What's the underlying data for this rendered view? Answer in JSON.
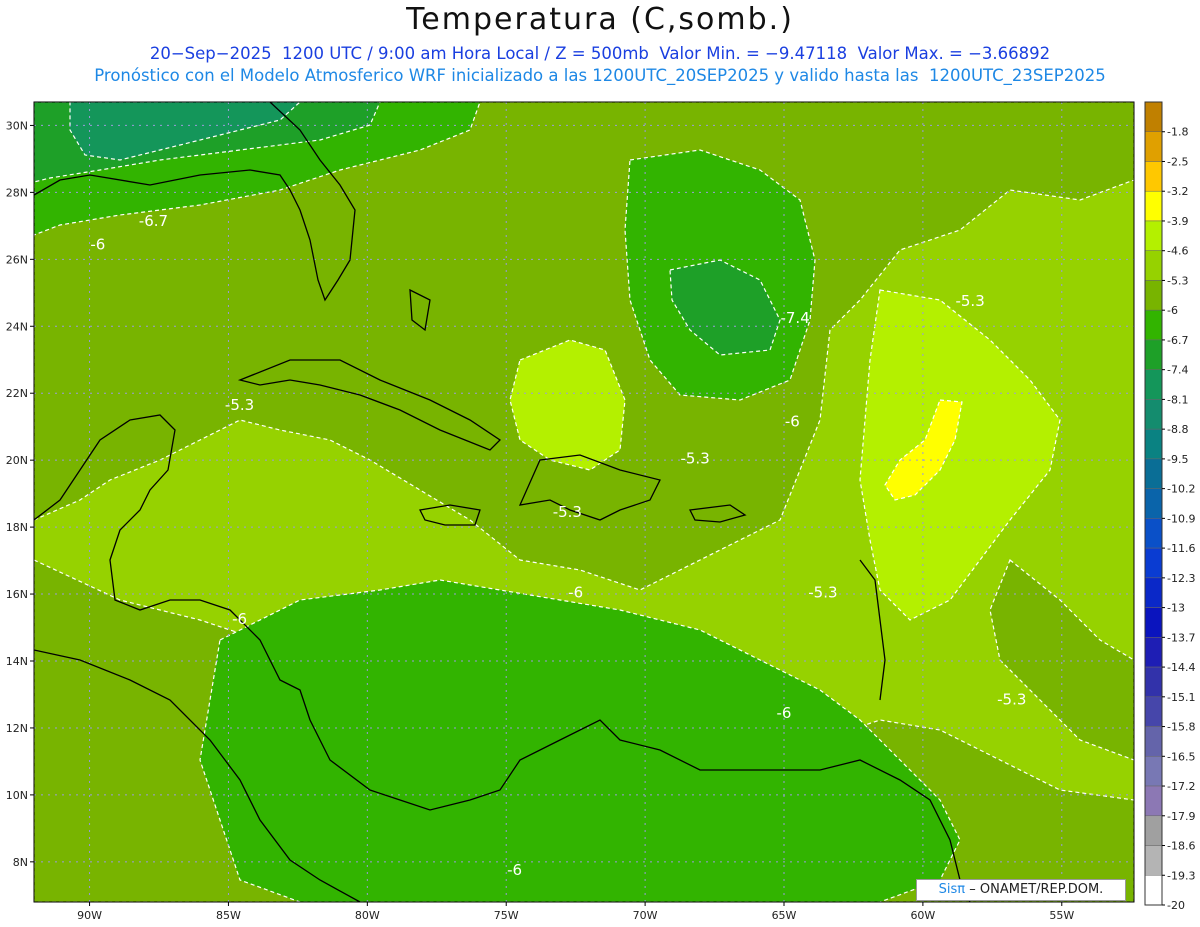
{
  "header": {
    "title": "Temperatura (C,somb.)",
    "line1": "20−Sep−2025  1200 UTC / 9:00 am Hora Local / Z = 500mb  Valor Min. = −9.47118  Valor Max. = −3.66892",
    "line2": "Pronóstico con el Modelo Atmosferico WRF inicializado a las 1200UTC_20SEP2025 y valido hasta las  1200UTC_23SEP2025"
  },
  "map": {
    "lat_ticks": [
      "30N",
      "28N",
      "26N",
      "24N",
      "22N",
      "20N",
      "18N",
      "16N",
      "14N",
      "12N",
      "10N",
      "8N"
    ],
    "lon_ticks": [
      "90W",
      "85W",
      "80W",
      "75W",
      "70W",
      "65W",
      "60W",
      "55W"
    ],
    "contour_labels": [
      {
        "text": "-6.7",
        "lon": -87.7,
        "lat": 27.0
      },
      {
        "text": "-6",
        "lon": -89.7,
        "lat": 26.3
      },
      {
        "text": "-7.4",
        "lon": -64.6,
        "lat": 24.1
      },
      {
        "text": "-5.3",
        "lon": -58.3,
        "lat": 24.6
      },
      {
        "text": "-5.3",
        "lon": -84.6,
        "lat": 21.5
      },
      {
        "text": "-6",
        "lon": -64.7,
        "lat": 21.0
      },
      {
        "text": "-5.3",
        "lon": -68.2,
        "lat": 19.9
      },
      {
        "text": "-5.3",
        "lon": -72.8,
        "lat": 18.3
      },
      {
        "text": "-6",
        "lon": -72.5,
        "lat": 15.9
      },
      {
        "text": "-5.3",
        "lon": -63.6,
        "lat": 15.9
      },
      {
        "text": "-6",
        "lon": -84.6,
        "lat": 15.1
      },
      {
        "text": "-6",
        "lon": -65.0,
        "lat": 12.3
      },
      {
        "text": "-5.3",
        "lon": -56.8,
        "lat": 12.7
      },
      {
        "text": "-6",
        "lon": -74.7,
        "lat": 7.6
      }
    ]
  },
  "colorbar": {
    "labels": [
      "-1.8",
      "-2.5",
      "-3.2",
      "-3.9",
      "-4.6",
      "-5.3",
      "-6",
      "-6.7",
      "-7.4",
      "-8.1",
      "-8.8",
      "-9.5",
      "-10.2",
      "-10.9",
      "-11.6",
      "-12.3",
      "-13",
      "-13.7",
      "-14.4",
      "-15.1",
      "-15.8",
      "-16.5",
      "-17.2",
      "-17.9",
      "-18.6",
      "-19.3",
      "-20"
    ],
    "colors": [
      "#c08000",
      "#e0a000",
      "#ffc800",
      "#ffff00",
      "#b4f000",
      "#96d200",
      "#78b400",
      "#32b400",
      "#1ea028",
      "#14965a",
      "#148c6e",
      "#0a8282",
      "#0a6e96",
      "#0a64aa",
      "#0a50c8",
      "#0a3cd2",
      "#0a28c8",
      "#0a14be",
      "#1e1eb4",
      "#3232aa",
      "#4646aa",
      "#6464aa",
      "#7878b4",
      "#8c78b4",
      "#a0a0a0",
      "#b4b4b4",
      "#ffffff"
    ],
    "bottom_color": "#e8e8e8"
  },
  "footer": {
    "credit_sis": "Sisπ",
    "credit_rest": "– ONAMET/REP.DOM."
  },
  "palette": {
    "fill_-5.3": "#96d200",
    "fill_-6": "#78b400",
    "fill_-6.7": "#32b400",
    "fill_-7.4": "#1ea028",
    "fill_-8.1": "#14965a",
    "fill_-4.6": "#b4f000",
    "fill_-3.9": "#ffff00"
  }
}
